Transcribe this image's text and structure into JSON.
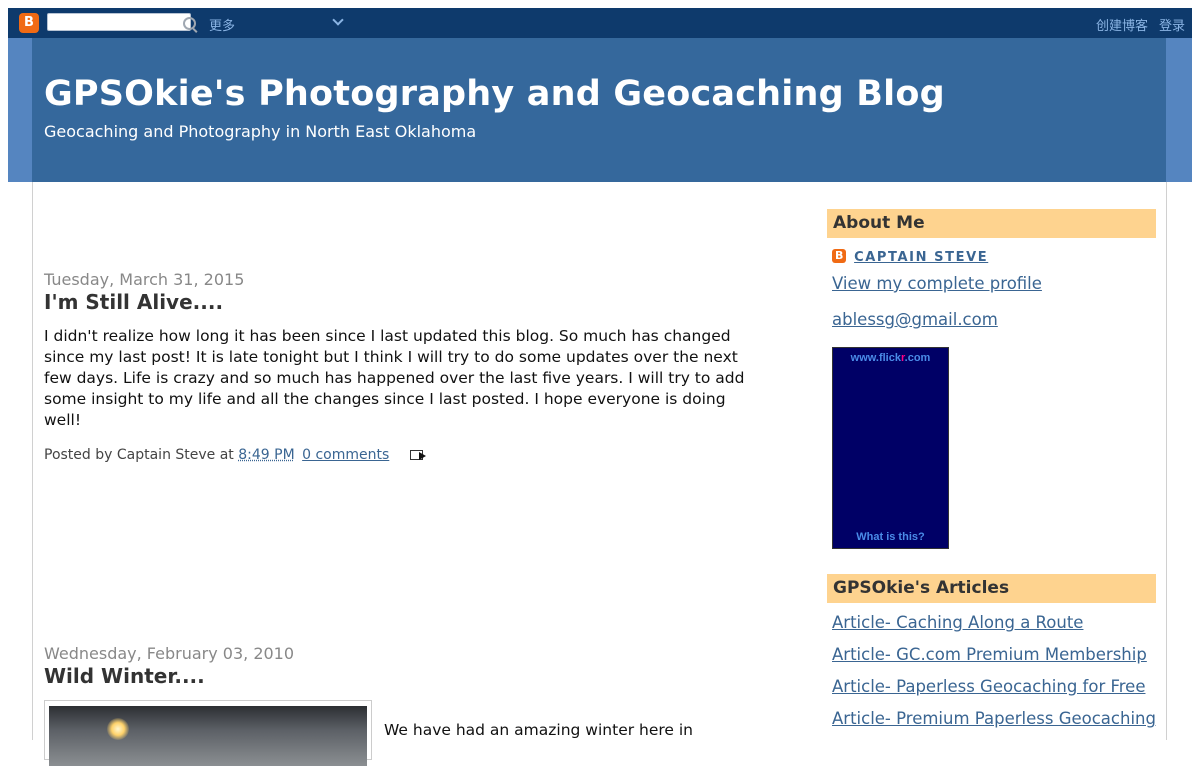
{
  "navbar": {
    "logo_letter": "B",
    "search_value": "",
    "more_label": "更多",
    "create_blog_label": "创建博客",
    "login_label": "登录"
  },
  "header": {
    "title": "GPSOkie's Photography and Geocaching Blog",
    "description": "Geocaching and Photography in North East Oklahoma"
  },
  "posts": [
    {
      "date": "Tuesday, March 31, 2015",
      "title": "I'm Still Alive....",
      "body": "I didn't realize how long it has been since I last updated this blog. So much has changed since my last post! It is late tonight but I think I will try to do some updates over the next few days. Life is crazy and so much has happened over the last five years. I will try to add some insight to my life and all the changes since I last posted. I hope everyone is doing well!",
      "posted_by": "Posted by Captain Steve at",
      "time": "8:49 PM",
      "comments": "0 comments",
      "email_icon": "email-post-icon"
    },
    {
      "date": "Wednesday, February 03, 2010",
      "title": "Wild Winter....",
      "intro": "We have had an amazing winter here in"
    }
  ],
  "sidebar": {
    "about": {
      "heading": "About Me",
      "profile_icon_letter": "B",
      "name": "CAPTAIN STEVE",
      "view_profile": "View my complete profile",
      "email": "ablessg@gmail.com"
    },
    "flickr": {
      "url_prefix": "www.flick",
      "url_r": "r",
      "url_suffix": ".com",
      "what_label": "What is this?"
    },
    "articles": {
      "heading": "GPSOkie's Articles",
      "items": [
        "Article- Caching Along a Route",
        "Article- GC.com Premium Membership",
        "Article- Paperless Geocaching for Free",
        "Article- Premium Paperless Geocaching"
      ]
    }
  },
  "colors": {
    "navbar_bg": "#0e3a6c",
    "header_bg": "#35689c",
    "header_band": "#5585c0",
    "sidebar_heading_bg": "#fed38f",
    "link": "#3a6592",
    "blogger_orange": "#f06a14",
    "flickr_bg": "#000066"
  }
}
